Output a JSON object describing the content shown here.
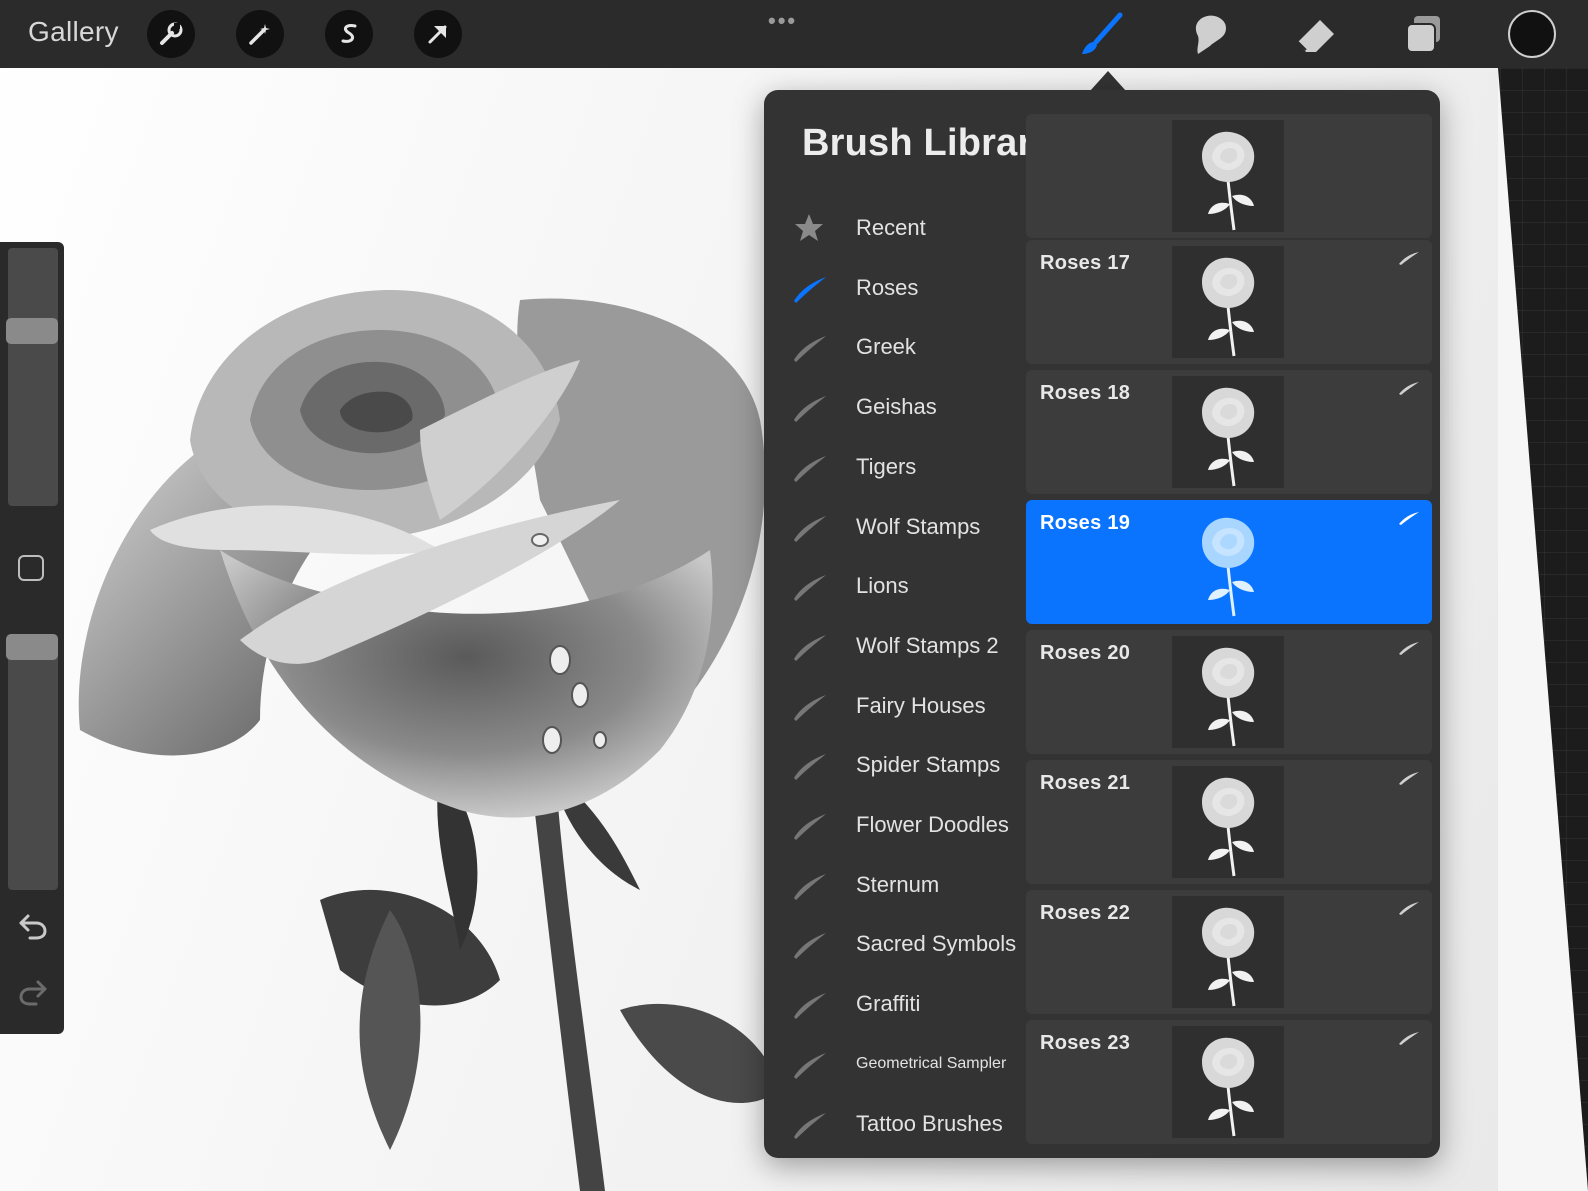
{
  "app": {
    "gallery_label": "Gallery",
    "more_label": "•••"
  },
  "toolbar": {
    "left_tools": [
      "wrench-icon",
      "magic-wand-icon",
      "selection-s-icon",
      "transform-arrow-icon"
    ],
    "right_tools": [
      "brush-icon",
      "smudge-icon",
      "eraser-icon",
      "layers-icon"
    ],
    "active_tool": "brush-icon",
    "accent_color": "#0a74ff",
    "current_color": "#111111"
  },
  "sidebar": {
    "size_slider_level": 0.3,
    "opacity_slider_level": 0.95,
    "undo_icon": "undo-icon",
    "redo_icon": "redo-icon"
  },
  "brush_library": {
    "title": "Brush Library",
    "add_label": "+",
    "sets": [
      {
        "label": "Recent",
        "icon": "star-icon",
        "active": false
      },
      {
        "label": "Roses",
        "icon": "brush-stroke-icon",
        "active": true
      },
      {
        "label": "Greek",
        "icon": "brush-stroke-icon",
        "active": false
      },
      {
        "label": "Geishas",
        "icon": "brush-stroke-icon",
        "active": false
      },
      {
        "label": "Tigers",
        "icon": "brush-stroke-icon",
        "active": false
      },
      {
        "label": "Wolf Stamps",
        "icon": "brush-stroke-icon",
        "active": false
      },
      {
        "label": "Lions",
        "icon": "brush-stroke-icon",
        "active": false
      },
      {
        "label": "Wolf Stamps 2",
        "icon": "brush-stroke-icon",
        "active": false
      },
      {
        "label": "Fairy Houses",
        "icon": "brush-stroke-icon",
        "active": false
      },
      {
        "label": "Spider Stamps",
        "icon": "brush-stroke-icon",
        "active": false
      },
      {
        "label": "Flower Doodles",
        "icon": "brush-stroke-icon",
        "active": false
      },
      {
        "label": "Sternum",
        "icon": "brush-stroke-icon",
        "active": false
      },
      {
        "label": "Sacred Symbols",
        "icon": "brush-stroke-icon",
        "active": false
      },
      {
        "label": "Graffiti",
        "icon": "brush-stroke-icon",
        "active": false
      },
      {
        "label": "Geometrical Sampler",
        "icon": "brush-stroke-icon",
        "active": false
      },
      {
        "label": "Tattoo Brushes",
        "icon": "brush-stroke-icon",
        "active": false
      }
    ],
    "brushes": [
      {
        "name": "",
        "selected": false,
        "partial": true
      },
      {
        "name": "Roses 17",
        "selected": false
      },
      {
        "name": "Roses 18",
        "selected": false
      },
      {
        "name": "Roses 19",
        "selected": true
      },
      {
        "name": "Roses 20",
        "selected": false
      },
      {
        "name": "Roses 21",
        "selected": false
      },
      {
        "name": "Roses 22",
        "selected": false
      },
      {
        "name": "Roses 23",
        "selected": false
      }
    ]
  }
}
